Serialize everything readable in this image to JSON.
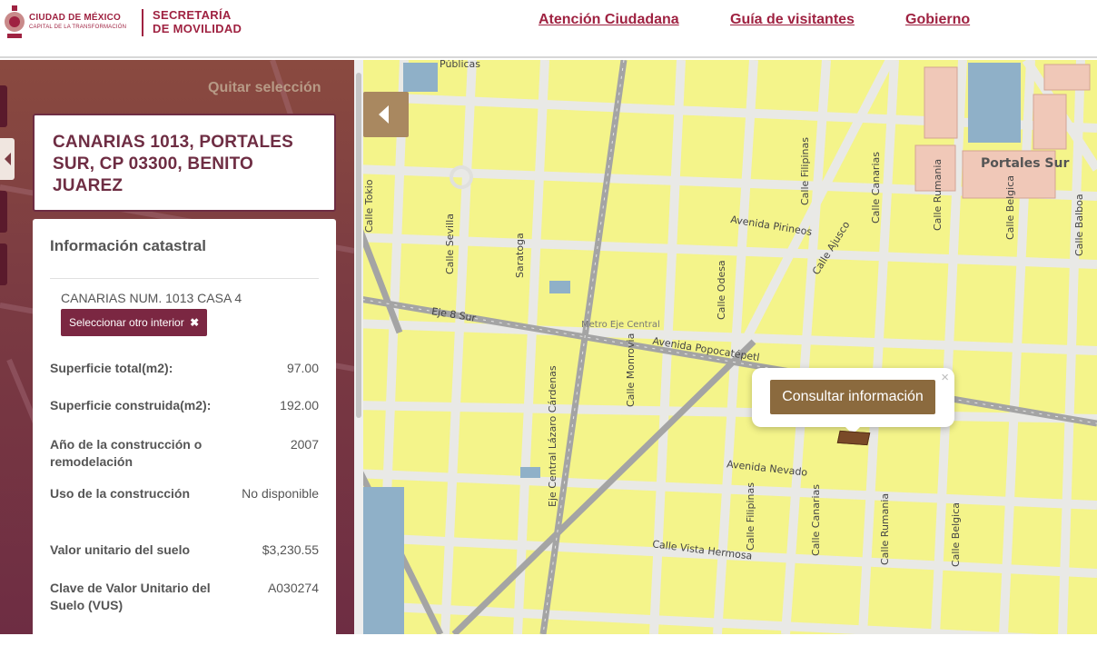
{
  "header": {
    "logo_city": "CIUDAD DE MÉXICO",
    "logo_city_sub": "CAPITAL DE LA TRANSFORMACIÓN",
    "logo_secretaria_line1": "SECRETARÍA",
    "logo_secretaria_line2": "DE MOVILIDAD",
    "nav": [
      {
        "label": "Atención Ciudadana"
      },
      {
        "label": "Guía de visitantes"
      },
      {
        "label": "Gobierno"
      }
    ]
  },
  "panel": {
    "quitar_label": "Quitar selección",
    "address": "CANARIAS 1013, PORTALES SUR, CP 03300, BENITO JUAREZ",
    "info_title": "Información catastral",
    "interior": "CANARIAS NUM. 1013 CASA 4",
    "select_other_label": "Seleccionar otro interior",
    "select_other_icon": "✖",
    "properties": [
      {
        "key": "Superficie total(m2):",
        "value": "97.00"
      },
      {
        "key": "Superficie construida(m2):",
        "value": "192.00"
      },
      {
        "key": "Año de la construcción o remodelación",
        "value": "2007"
      },
      {
        "key": "Uso de la construcción",
        "value": "No disponible"
      },
      {
        "key": "Valor unitario del suelo",
        "value": "$3,230.55"
      },
      {
        "key": "Clave de Valor Unitario del Suelo (VUS)",
        "value": "A030274"
      }
    ]
  },
  "map": {
    "consultar_label": "Consultar información",
    "close_label": "×",
    "labels": {
      "portales_sur": "Portales Sur",
      "eje8": "Eje 8 Sur",
      "pirineos": "Avenida Pirineos",
      "popocatepetl": "Avenida Popocatépetl",
      "nevado": "Avenida Nevado",
      "vista_hermosa": "Calle Vista Hermosa",
      "metro": "Metro Eje Central",
      "sevilla": "Calle Sevilla",
      "saratoga": "Saratoga",
      "tokio": "Calle Tokio",
      "filipinas1": "Calle Filipinas",
      "filipinas2": "Calle Filipinas",
      "odesa": "Calle Odesa",
      "ajusco": "Calle Ajusco",
      "canarias1": "Calle Canarias",
      "canarias2": "Calle Canarias",
      "rumania1": "Calle Rumania",
      "rumania2": "Calle Rumania",
      "belgica1": "Calle Belgica",
      "belgica2": "Calle Belgica",
      "balboa": "Calle Balboa",
      "monrovia": "Calle Monrovia",
      "eje_central": "Eje Central Lázaro Cárdenas",
      "publicas": "Públicas"
    }
  }
}
